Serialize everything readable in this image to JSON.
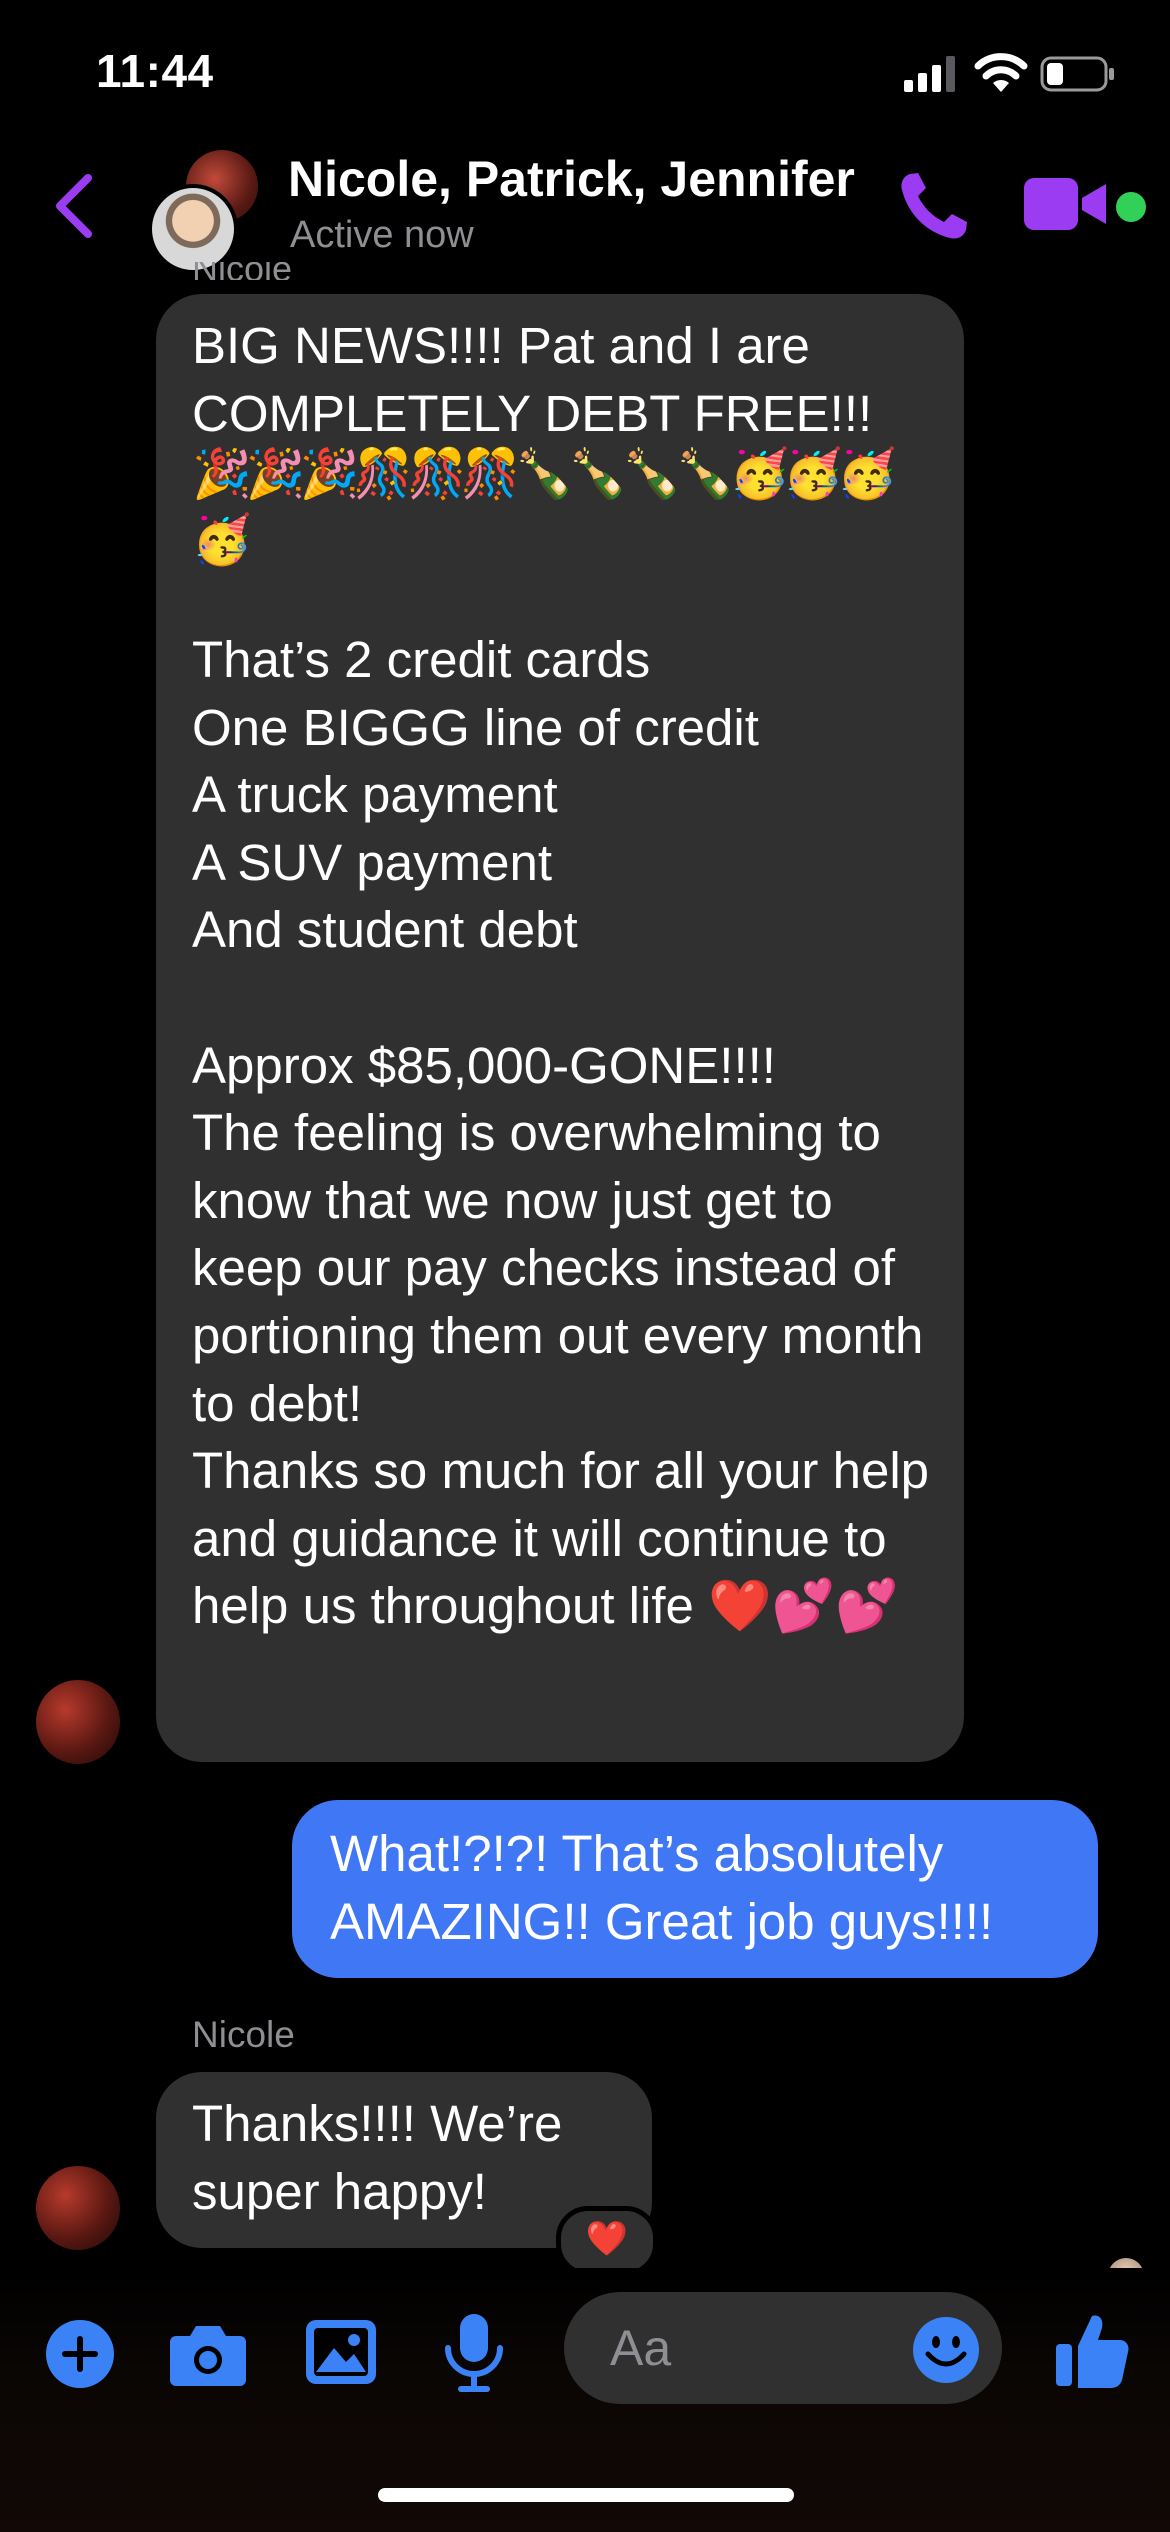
{
  "status_bar": {
    "time": "11:44"
  },
  "header": {
    "title": "Nicole, Patrick, Jennifer",
    "status": "Active now",
    "accent_color": "#9b3cf2"
  },
  "messages": [
    {
      "direction": "incoming",
      "text_line1": "BIG NEWS!!!! Pat and I are COMPLETELY DEBT FREE!!!",
      "emoji": "🎉🎉🎉🎊🎊🎊🍾🍾🍾🍾🥳🥳🥳🥳",
      "body": "That’s 2 credit cards\nOne BIGGG line of credit\nA truck payment\nA SUV payment\nAnd student debt\n\nApprox $85,000-GONE!!!!\nThe feeling is overwhelming to know that we now just get to keep our pay checks instead of portioning them out every month to debt!\nThanks so much for all your help and guidance it will continue to help us throughout life ❤️💕💕"
    },
    {
      "direction": "outgoing",
      "text": "What!?!?! That’s absolutely AMAZING!! Great job guys!!!!"
    },
    {
      "direction": "incoming",
      "sender": "Nicole",
      "text": "Thanks!!!! We’re super happy!",
      "reaction": "❤️"
    }
  ],
  "composer": {
    "placeholder": "Aa",
    "accent_color": "#3b82f6"
  },
  "colors": {
    "incoming_bubble": "#303030",
    "outgoing_bubble": "#3f77f5",
    "secondary_text": "#8e8e93"
  }
}
